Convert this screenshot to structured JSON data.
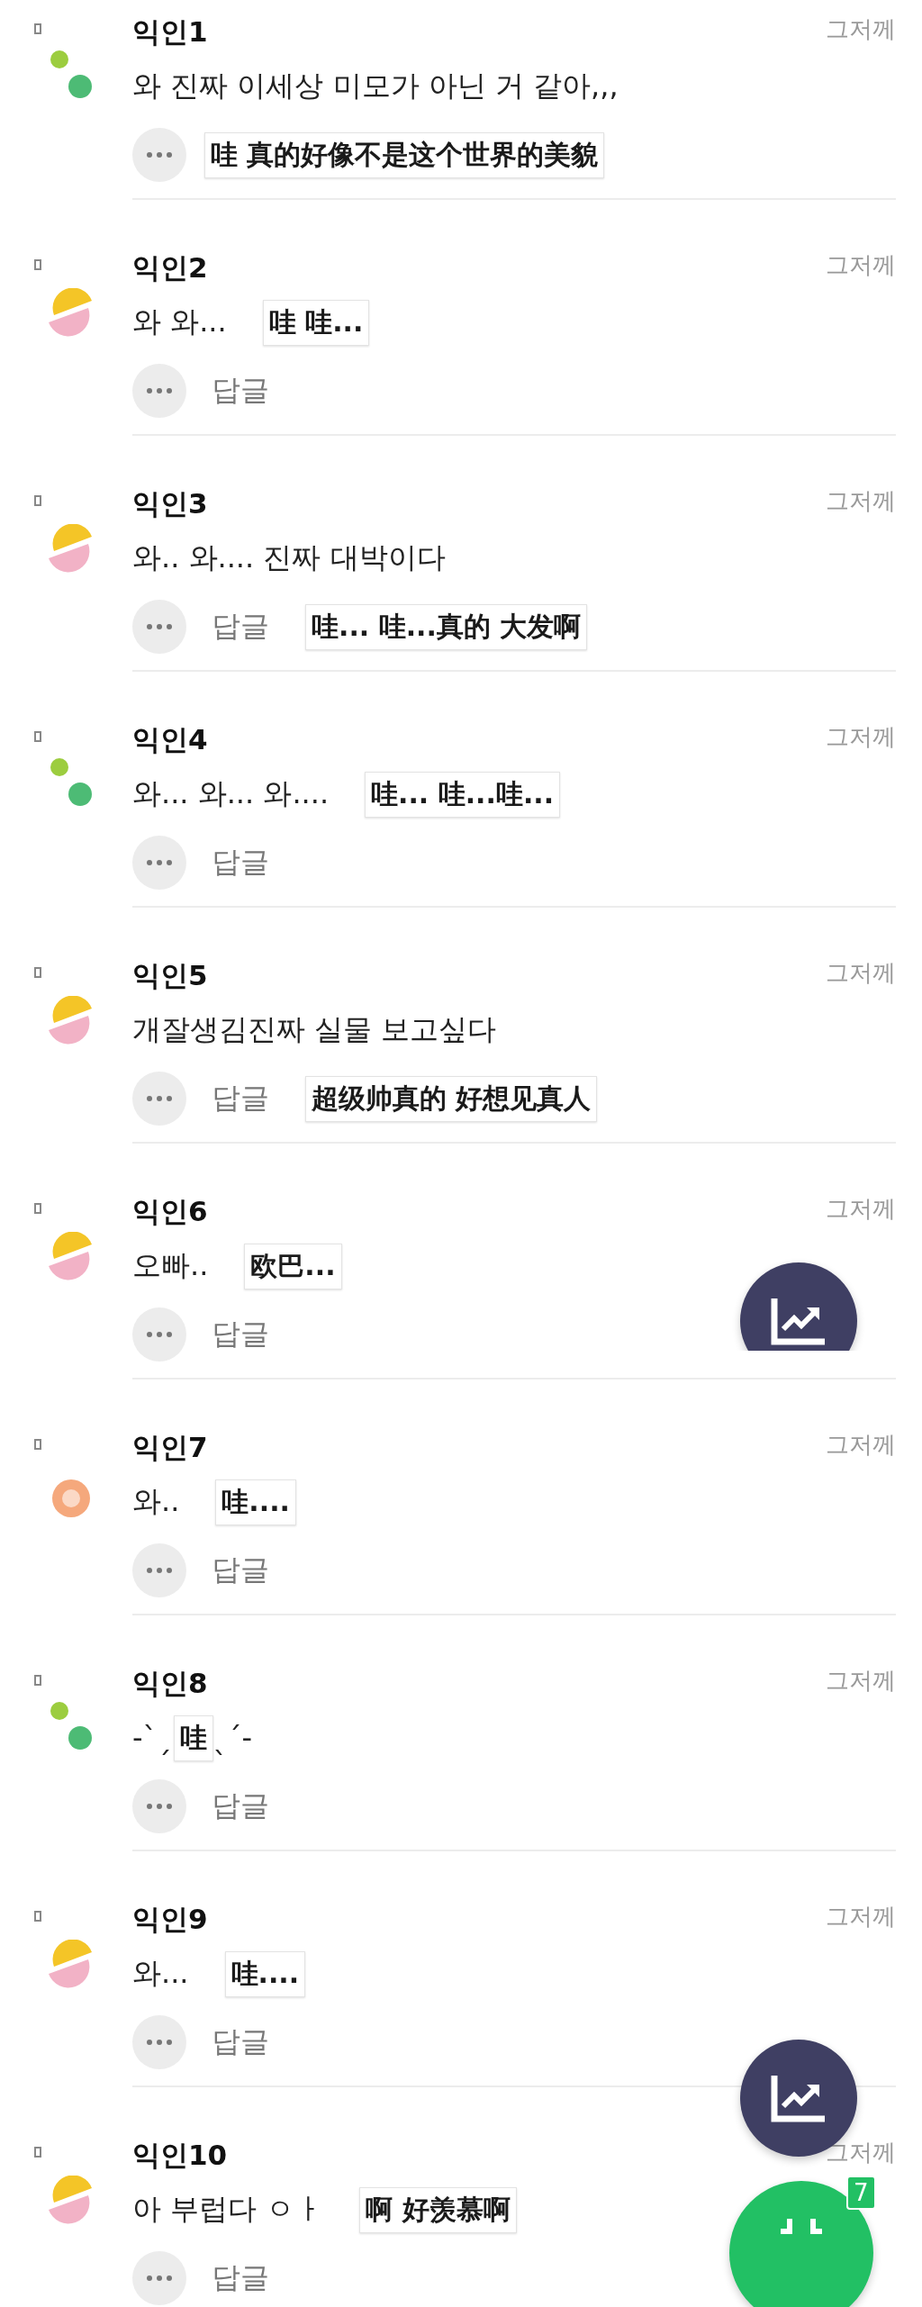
{
  "comments": [
    {
      "name": "익인1",
      "time": "그저께",
      "avatar": {
        "kind": "dots"
      },
      "text": "와 진짜 이세상 미모가 아닌 거 같아,,,",
      "sticker": {
        "text": "哇 真的好像不是这个世界的美貌",
        "kind": "reply"
      }
    },
    {
      "name": "익인2",
      "time": "그저께",
      "avatar": {
        "kind": "half"
      },
      "text": "와 와...",
      "reply_label": "답글",
      "sticker": {
        "text": "哇 哇...",
        "kind": "text"
      }
    },
    {
      "name": "익인3",
      "time": "그저께",
      "avatar": {
        "kind": "half"
      },
      "text": "와.. 와.... 진짜 대박이다",
      "reply_label": "답글",
      "sticker": {
        "text": "哇... 哇...真的 大发啊",
        "kind": "reply"
      }
    },
    {
      "name": "익인4",
      "time": "그저께",
      "avatar": {
        "kind": "dots"
      },
      "text": "와... 와... 와....",
      "reply_label": "답글",
      "sticker": {
        "text": "哇... 哇...哇...",
        "kind": "text"
      }
    },
    {
      "name": "익인5",
      "time": "그저께",
      "avatar": {
        "kind": "half"
      },
      "text": "개잘생김진짜 실물 보고싶다",
      "reply_label": "답글",
      "sticker": {
        "text": "超级帅真的 好想见真人",
        "kind": "reply"
      }
    },
    {
      "name": "익인6",
      "time": "그저께",
      "avatar": {
        "kind": "half"
      },
      "text": "오빠..",
      "reply_label": "답글",
      "sticker": {
        "text": "欧巴...",
        "kind": "text"
      }
    },
    {
      "name": "익인7",
      "time": "그저께",
      "avatar": {
        "kind": "ring"
      },
      "text": "와..",
      "reply_label": "답글",
      "sticker": {
        "text": "哇....",
        "kind": "text"
      }
    },
    {
      "name": "익인8",
      "time": "그저께",
      "avatar": {
        "kind": "dots"
      },
      "text": "-ˋˏ",
      "text_after": "ˎˊ-",
      "reply_label": "답글",
      "sticker": {
        "text": "哇",
        "kind": "text"
      }
    },
    {
      "name": "익인9",
      "time": "그저께",
      "avatar": {
        "kind": "half"
      },
      "text": "와...",
      "reply_label": "답글",
      "sticker": {
        "text": "哇....",
        "kind": "text"
      }
    },
    {
      "name": "익인10",
      "time": "그저께",
      "avatar": {
        "kind": "half"
      },
      "text": "아 부럽다 ㅇㅏ",
      "reply_label": "답글",
      "sticker": {
        "text": "啊 好羡慕啊",
        "kind": "text"
      }
    }
  ],
  "fab": {
    "badge": "7"
  }
}
